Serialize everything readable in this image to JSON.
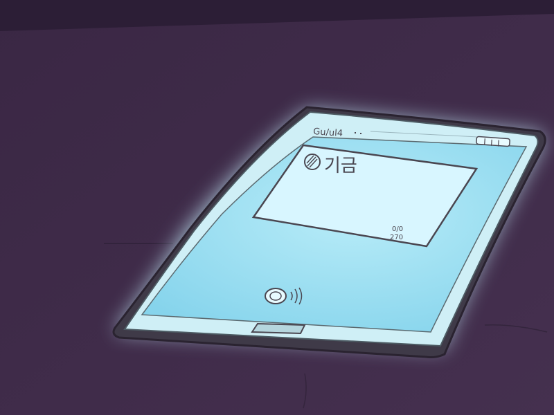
{
  "scene": {
    "subject": "illustrated tablet lying face-up on a dark purple surface, screen glowing",
    "colors": {
      "background": "#3f2b49",
      "background_dark": "#2c1e36",
      "glow": "#c8f4ff",
      "device_frame": "#4d5b63",
      "screen": "#a7e6f6",
      "screen_bright": "#d8f7ff",
      "outline": "#3b3340"
    }
  },
  "tablet": {
    "status_bar": {
      "carrier_text": "Gu/ul4",
      "battery_icon": "battery-icon"
    },
    "notification_card": {
      "app_icon": "app-logo-icon",
      "title_text": "기금",
      "footer_text_line1": "0/0",
      "footer_text_line2": "270"
    },
    "home_button_icon": "home-button-icon",
    "sound_icon": "sound-waves-icon"
  }
}
